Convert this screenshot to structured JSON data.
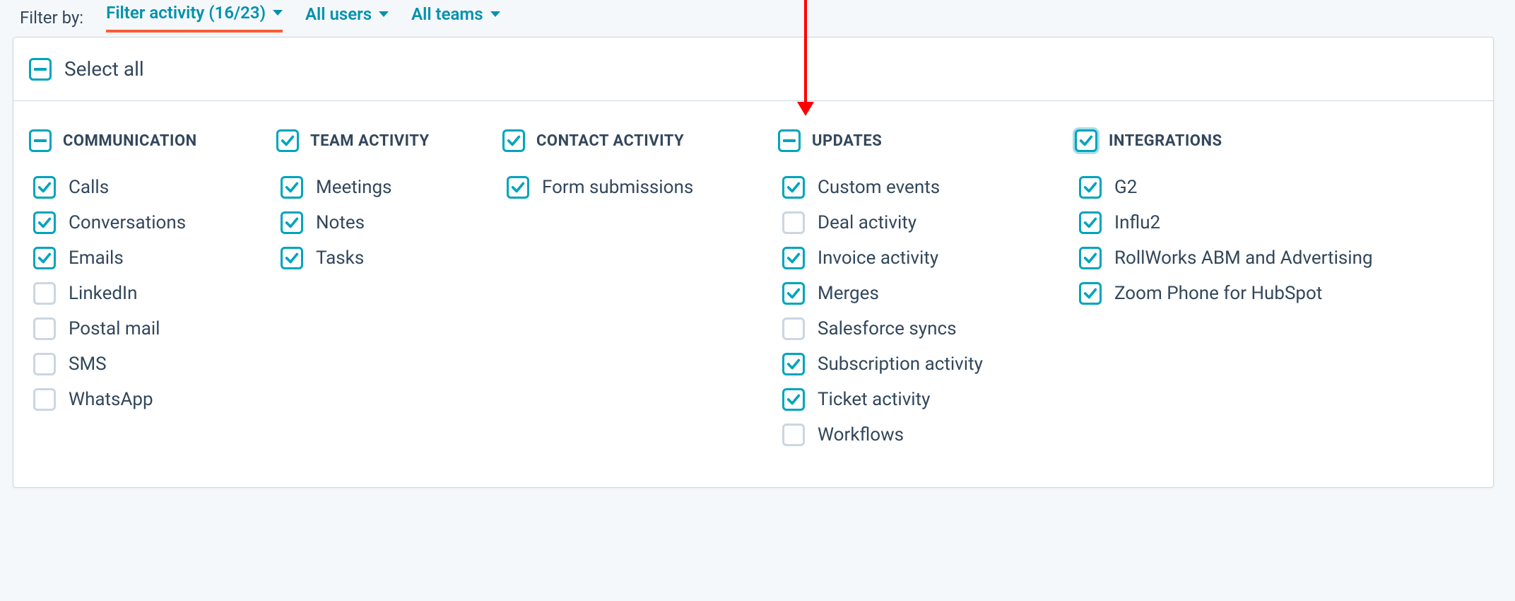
{
  "filterBar": {
    "label": "Filter by:",
    "activityPill": "Filter activity (16/23)",
    "usersPill": "All users",
    "teamsPill": "All teams"
  },
  "selectAll": {
    "label": "Select all",
    "state": "indeterminate"
  },
  "columns": {
    "communication": {
      "title": "COMMUNICATION",
      "state": "indeterminate",
      "items": [
        {
          "label": "Calls",
          "checked": true
        },
        {
          "label": "Conversations",
          "checked": true
        },
        {
          "label": "Emails",
          "checked": true
        },
        {
          "label": "LinkedIn",
          "checked": false
        },
        {
          "label": "Postal mail",
          "checked": false
        },
        {
          "label": "SMS",
          "checked": false
        },
        {
          "label": "WhatsApp",
          "checked": false
        }
      ]
    },
    "teamActivity": {
      "title": "TEAM ACTIVITY",
      "state": "checked",
      "items": [
        {
          "label": "Meetings",
          "checked": true
        },
        {
          "label": "Notes",
          "checked": true
        },
        {
          "label": "Tasks",
          "checked": true
        }
      ]
    },
    "contactActivity": {
      "title": "CONTACT ACTIVITY",
      "state": "checked",
      "items": [
        {
          "label": "Form submissions",
          "checked": true
        }
      ]
    },
    "updates": {
      "title": "UPDATES",
      "state": "indeterminate",
      "items": [
        {
          "label": "Custom events",
          "checked": true
        },
        {
          "label": "Deal activity",
          "checked": false
        },
        {
          "label": "Invoice activity",
          "checked": true
        },
        {
          "label": "Merges",
          "checked": true
        },
        {
          "label": "Salesforce syncs",
          "checked": false
        },
        {
          "label": "Subscription activity",
          "checked": true
        },
        {
          "label": "Ticket activity",
          "checked": true
        },
        {
          "label": "Workflows",
          "checked": false
        }
      ]
    },
    "integrations": {
      "title": "INTEGRATIONS",
      "state": "checked",
      "highlight": true,
      "items": [
        {
          "label": "G2",
          "checked": true
        },
        {
          "label": "Influ2",
          "checked": true
        },
        {
          "label": "RollWorks ABM and Advertising",
          "checked": true
        },
        {
          "label": "Zoom Phone for HubSpot",
          "checked": true
        }
      ]
    }
  }
}
